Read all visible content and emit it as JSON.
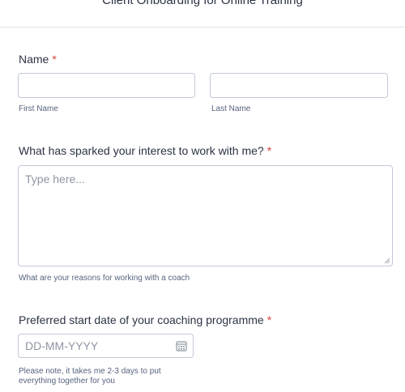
{
  "form": {
    "title": "Client Onboarding for Online Training"
  },
  "name_question": {
    "label": "Name",
    "required_mark": "*",
    "first_name_value": "",
    "last_name_value": "",
    "first_name_sublabel": "First Name",
    "last_name_sublabel": "Last Name"
  },
  "interest_question": {
    "label": "What has sparked your interest to work with me?",
    "required_mark": "*",
    "placeholder": "Type here...",
    "value": "",
    "sublabel": "What are your reasons for working with a coach"
  },
  "start_date_question": {
    "label": "Preferred start date of your coaching programme",
    "required_mark": "*",
    "placeholder": "DD-MM-YYYY",
    "value": "",
    "note": "Please note, it takes me 2-3 days to put everything together for you"
  },
  "icons": {
    "date_picker": "calendar-icon",
    "textarea_resize": "resize-handle-icon"
  },
  "colors": {
    "required": "#d9423f",
    "text": "#2c3345",
    "input_border": "#c3cad8",
    "placeholder": "#8f96a3"
  }
}
